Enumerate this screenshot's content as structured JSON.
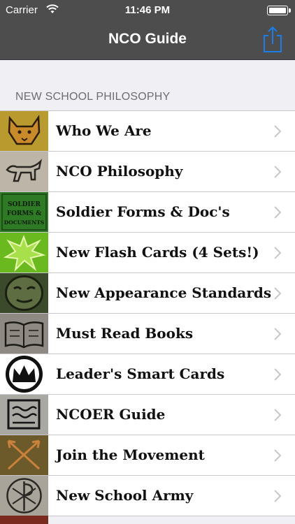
{
  "status": {
    "carrier": "Carrier",
    "time": "11:46 PM"
  },
  "nav": {
    "title": "NCO Guide",
    "share_icon": "share-icon"
  },
  "section": {
    "header": "NEW SCHOOL PHILOSOPHY"
  },
  "rows": [
    {
      "label": "Who We Are",
      "icon": "fox-icon",
      "bg": "#b99a2e"
    },
    {
      "label": "NCO Philosophy",
      "icon": "running-dog-icon",
      "bg": "#bdb6a8"
    },
    {
      "label": "Soldier Forms & Doc's",
      "icon": "soldier-forms-badge-icon",
      "bg": "#2f7a24",
      "badge_text": "SOLDIER FORMS & DOCUMENTS"
    },
    {
      "label": "New Flash Cards (4 Sets!)",
      "icon": "starburst-icon",
      "bg": "#6ab91f"
    },
    {
      "label": "New Appearance Standards",
      "icon": "face-icon",
      "bg": "#3a4a2a"
    },
    {
      "label": "Must Read Books",
      "icon": "open-book-icon",
      "bg": "#8e8a83"
    },
    {
      "label": "Leader's Smart Cards",
      "icon": "crown-circle-icon",
      "bg": "#ffffff"
    },
    {
      "label": "NCOER Guide",
      "icon": "scroll-waves-icon",
      "bg": "#aaa8a3"
    },
    {
      "label": "Join the Movement",
      "icon": "crossed-arrows-icon",
      "bg": "#6d5a2a"
    },
    {
      "label": "New School Army",
      "icon": "chi-rho-icon",
      "bg": "#a9a49a"
    }
  ]
}
